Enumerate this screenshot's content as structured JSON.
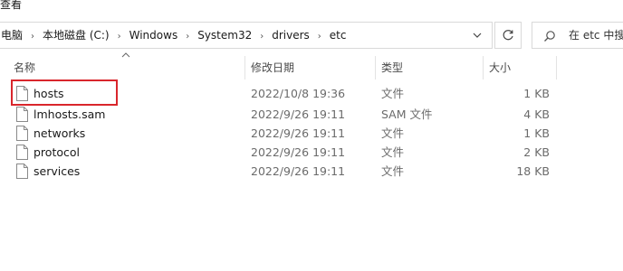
{
  "menu": {
    "view_label": "查看"
  },
  "address_bar": {
    "crumbs": [
      "电脑",
      "本地磁盘 (C:)",
      "Windows",
      "System32",
      "drivers",
      "etc"
    ],
    "separator": "›"
  },
  "search": {
    "placeholder": "在 etc 中搜"
  },
  "columns": {
    "name": "名称",
    "date": "修改日期",
    "type": "类型",
    "size": "大小"
  },
  "files": [
    {
      "name": "hosts",
      "date": "2022/10/8 19:36",
      "type": "文件",
      "size": "1 KB",
      "highlighted": true
    },
    {
      "name": "lmhosts.sam",
      "date": "2022/9/26 19:11",
      "type": "SAM 文件",
      "size": "4 KB"
    },
    {
      "name": "networks",
      "date": "2022/9/26 19:11",
      "type": "文件",
      "size": "1 KB"
    },
    {
      "name": "protocol",
      "date": "2022/9/26 19:11",
      "type": "文件",
      "size": "2 KB"
    },
    {
      "name": "services",
      "date": "2022/9/26 19:11",
      "type": "文件",
      "size": "18 KB"
    }
  ],
  "icons": {
    "file": "file-icon",
    "dropdown": "chevron-down-icon",
    "refresh": "refresh-icon",
    "search": "search-icon",
    "sort": "sort-ascending-icon"
  },
  "colors": {
    "highlight_border": "#d9262c"
  }
}
